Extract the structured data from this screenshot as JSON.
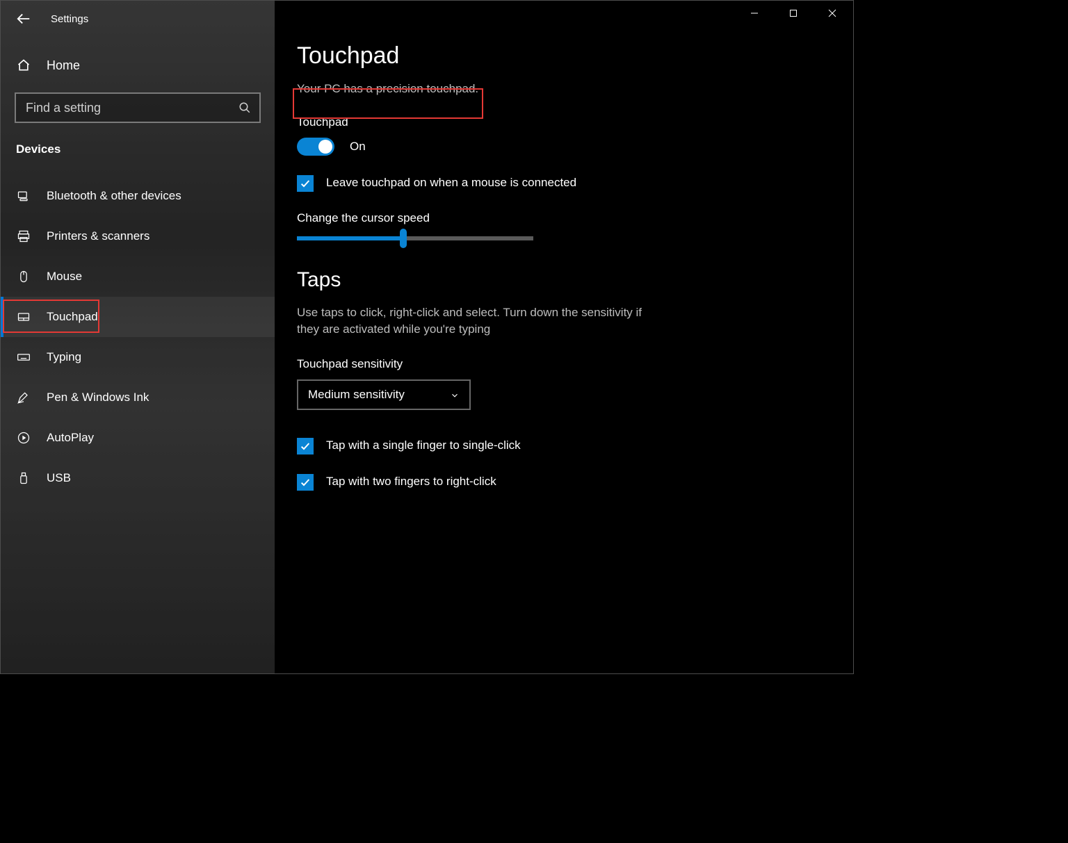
{
  "window_title": "Settings",
  "header": {
    "home_label": "Home",
    "search_placeholder": "Find a setting"
  },
  "sidebar": {
    "group_label": "Devices",
    "items": [
      {
        "label": "Bluetooth & other devices"
      },
      {
        "label": "Printers & scanners"
      },
      {
        "label": "Mouse"
      },
      {
        "label": "Touchpad"
      },
      {
        "label": "Typing"
      },
      {
        "label": "Pen & Windows Ink"
      },
      {
        "label": "AutoPlay"
      },
      {
        "label": "USB"
      }
    ],
    "active_index": 3
  },
  "main": {
    "title": "Touchpad",
    "precision_text": "Your PC has a precision touchpad.",
    "toggle_label": "Touchpad",
    "toggle_state": "On",
    "leave_on_label": "Leave touchpad on when a mouse is connected",
    "cursor_speed_label": "Change the cursor speed",
    "cursor_speed_percent": 45,
    "taps_heading": "Taps",
    "taps_desc": "Use taps to click, right-click and select. Turn down the sensitivity if they are activated while you're typing",
    "sensitivity_label": "Touchpad sensitivity",
    "sensitivity_value": "Medium sensitivity",
    "tap_single_label": "Tap with a single finger to single-click",
    "tap_two_label": "Tap with two fingers to right-click"
  },
  "colors": {
    "accent": "#0a84d4",
    "highlight": "#e53935"
  }
}
